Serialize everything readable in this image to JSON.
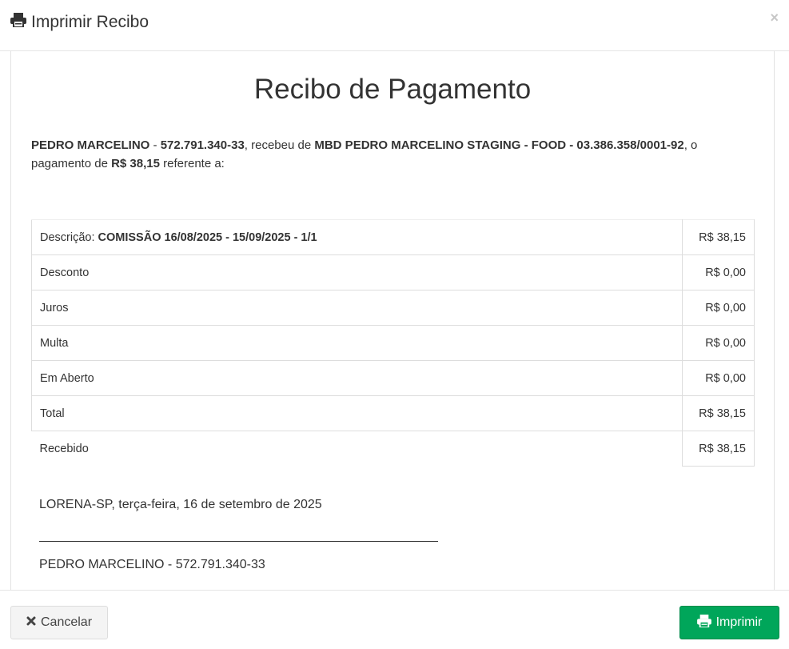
{
  "modal": {
    "title": "Imprimir Recibo",
    "close_label": "×"
  },
  "receipt": {
    "heading": "Recibo de Pagamento",
    "payee": "PEDRO MARCELINO",
    "payee_sep": " - ",
    "payee_doc": "572.791.340-33",
    "received_from_text": ", recebeu de ",
    "payer": "MBD PEDRO MARCELINO STAGING - FOOD - 03.386.358/0001-92",
    "payment_text": ", o pagamento de ",
    "amount": "R$ 38,15",
    "referring_text": " referente a:",
    "items": [
      {
        "label": "Descrição: ",
        "bold": "COMISSÃO 16/08/2025 - 15/09/2025 - 1/1",
        "value": "R$ 38,15"
      },
      {
        "label": "Desconto",
        "bold": "",
        "value": "R$ 0,00"
      },
      {
        "label": "Juros",
        "bold": "",
        "value": "R$ 0,00"
      },
      {
        "label": "Multa",
        "bold": "",
        "value": "R$ 0,00"
      },
      {
        "label": "Em Aberto",
        "bold": "",
        "value": "R$ 0,00"
      },
      {
        "label": "Total",
        "bold": "",
        "value": "R$ 38,15"
      },
      {
        "label": "Recebido",
        "bold": "",
        "value": "R$ 38,15"
      }
    ],
    "place_date": "LORENA-SP, terça-feira, 16 de setembro de 2025",
    "signer": "PEDRO MARCELINO - 572.791.340-33"
  },
  "footer": {
    "cancel_label": "Cancelar",
    "print_label": "Imprimir"
  },
  "colors": {
    "print_button": "#00a65a",
    "cancel_button": "#f4f4f4"
  },
  "icons": {
    "title": "printer-icon",
    "cancel": "times-icon",
    "print": "printer-icon"
  }
}
